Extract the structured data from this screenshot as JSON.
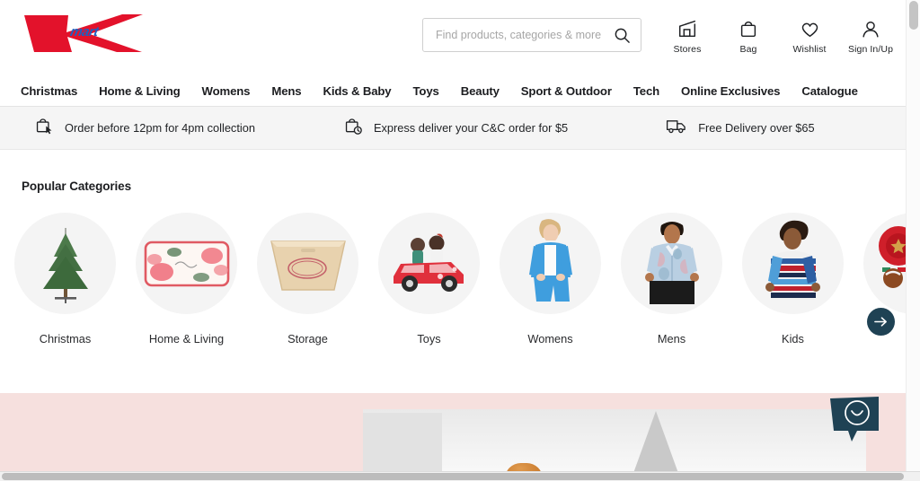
{
  "brand": {
    "name": "Kmart",
    "logo_k_color": "#e3122b",
    "logo_mart_color": "#1f5fc0",
    "mart_text": "mart"
  },
  "search": {
    "placeholder": "Find products, categories & more",
    "value": "",
    "icon": "search-icon"
  },
  "header_utilities": [
    {
      "label": "Stores",
      "icon": "store-icon"
    },
    {
      "label": "Bag",
      "icon": "shopping-bag-icon"
    },
    {
      "label": "Wishlist",
      "icon": "heart-icon"
    },
    {
      "label": "Sign In/Up",
      "icon": "user-icon"
    }
  ],
  "nav": {
    "items": [
      {
        "label": "Christmas"
      },
      {
        "label": "Home & Living"
      },
      {
        "label": "Womens"
      },
      {
        "label": "Mens"
      },
      {
        "label": "Kids & Baby"
      },
      {
        "label": "Toys"
      },
      {
        "label": "Beauty"
      },
      {
        "label": "Sport & Outdoor"
      },
      {
        "label": "Tech"
      },
      {
        "label": "Online Exclusives"
      },
      {
        "label": "Catalogue"
      }
    ]
  },
  "info_bar": {
    "items": [
      {
        "text": "Order before 12pm for 4pm collection",
        "icon": "click-and-collect-icon"
      },
      {
        "text": "Express deliver your C&C order for $5",
        "icon": "express-collect-icon"
      },
      {
        "text": "Free Delivery over $65",
        "icon": "delivery-truck-icon"
      }
    ]
  },
  "popular_categories": {
    "title": "Popular Categories",
    "next_button_icon": "arrow-right-icon",
    "tiles": [
      {
        "label": "Christmas",
        "image": "christmas-tree-photo"
      },
      {
        "label": "Home & Living",
        "image": "floral-cushion-photo"
      },
      {
        "label": "Storage",
        "image": "wooden-storage-box-photo"
      },
      {
        "label": "Toys",
        "image": "dolls-in-red-car-photo"
      },
      {
        "label": "Womens",
        "image": "woman-in-blue-outfit-photo"
      },
      {
        "label": "Mens",
        "image": "man-in-floral-shirt-photo"
      },
      {
        "label": "Kids",
        "image": "boy-in-striped-tee-photo"
      },
      {
        "label": "",
        "image": "christmas-bauble-photo"
      }
    ]
  },
  "hero_banner": {
    "background_color": "#f6e0de",
    "image": "kitchen-shelf-scene-photo"
  },
  "chat_widget": {
    "icon": "smiley-chat-icon",
    "color": "#1f4254"
  },
  "scrollbars": {
    "vertical": "page-vertical-scrollbar",
    "horizontal": "page-horizontal-scrollbar"
  }
}
